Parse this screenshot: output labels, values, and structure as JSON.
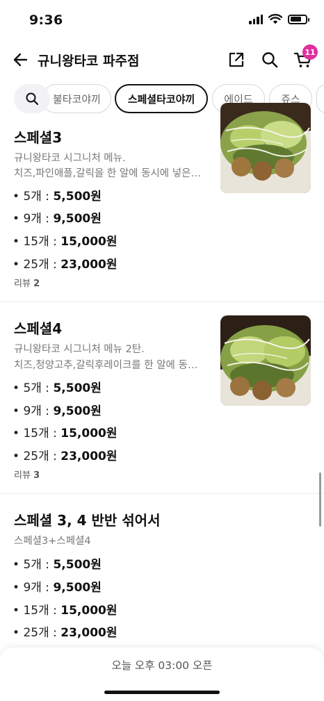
{
  "status": {
    "time": "9:36"
  },
  "header": {
    "title": "규니왕타코 파주점",
    "cart_count": "11"
  },
  "tabs": [
    {
      "label": "불타코야끼",
      "active": false
    },
    {
      "label": "스페셜타코야끼",
      "active": true
    },
    {
      "label": "에이드",
      "active": false
    },
    {
      "label": "쥬스",
      "active": false
    }
  ],
  "menu": [
    {
      "name": "스페셜3",
      "desc_lines": [
        "규니왕타코 시그니처 메뉴.",
        "치즈,파인애플,갈릭을 한 알에 동시에 넣은…"
      ],
      "prices": [
        {
          "qty": "5개",
          "price": "5,500원"
        },
        {
          "qty": "9개",
          "price": "9,500원"
        },
        {
          "qty": "15개",
          "price": "15,000원"
        },
        {
          "qty": "25개",
          "price": "23,000원"
        }
      ],
      "review_label": "리뷰",
      "review_count": "2"
    },
    {
      "name": "스페셜4",
      "desc_lines": [
        "규니왕타코 시그니처 메뉴 2탄.",
        "치즈,청양고추,갈릭후레이크를  한 알에 동…"
      ],
      "prices": [
        {
          "qty": "5개",
          "price": "5,500원"
        },
        {
          "qty": "9개",
          "price": "9,500원"
        },
        {
          "qty": "15개",
          "price": "15,000원"
        },
        {
          "qty": "25개",
          "price": "23,000원"
        }
      ],
      "review_label": "리뷰",
      "review_count": "3"
    },
    {
      "name": "스페셜 3, 4 반반 섞어서",
      "desc_lines": [
        "스페셜3+스페셜4"
      ],
      "prices": [
        {
          "qty": "5개",
          "price": "5,500원"
        },
        {
          "qty": "9개",
          "price": "9,500원"
        },
        {
          "qty": "15개",
          "price": "15,000원"
        },
        {
          "qty": "25개",
          "price": "23,000원"
        }
      ]
    }
  ],
  "bottom": {
    "open_text": "오늘 오후 03:00 오픈"
  },
  "colors": {
    "badge": "#e0309e",
    "text": "#111111",
    "muted": "#777777"
  }
}
